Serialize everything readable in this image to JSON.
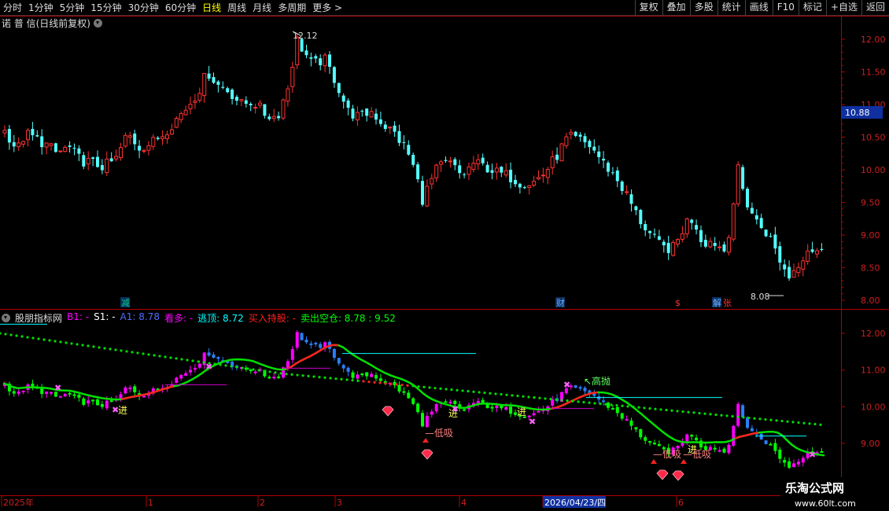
{
  "toolbar": {
    "periods": [
      "分时",
      "1分钟",
      "5分钟",
      "15分钟",
      "30分钟",
      "60分钟",
      "日线",
      "周线",
      "月线",
      "多周期",
      "更多 >"
    ],
    "active_period": "日线",
    "buttons": [
      "复权",
      "叠加",
      "多股",
      "统计",
      "画线",
      "F10",
      "标记",
      "+自选",
      "返回"
    ]
  },
  "main_chart": {
    "title": "诺 普 信(日线前复权)",
    "high_label": "12.12",
    "low_label": "8.08",
    "current_price": "10.88",
    "price_axis": [
      "12.00",
      "11.50",
      "11.00",
      "10.50",
      "10.00",
      "9.50",
      "9.00",
      "8.50",
      "8.00"
    ],
    "event_markers": [
      "减",
      "财",
      "$",
      "解",
      "张"
    ]
  },
  "indicator": {
    "name": "股朋指标网",
    "fields": [
      {
        "label": "B1: -",
        "color": "#ff00ff"
      },
      {
        "label": "S1: -",
        "color": "#ffffff"
      },
      {
        "label": "A1: 8.78",
        "color": "#4f6bff"
      },
      {
        "label": "看多: -",
        "color": "#ff00ff"
      },
      {
        "label": "逃顶: 8.72",
        "color": "#00ffff"
      },
      {
        "label": "买入持股: -",
        "color": "#ff2020"
      },
      {
        "label": "卖出空仓: 8.78 : 9.52",
        "color": "#00ff00"
      }
    ],
    "axis": [
      "12.00",
      "11.00",
      "10.00",
      "9.00"
    ],
    "annotations": {
      "enter": "进",
      "low_buy": "低吸",
      "high_sell": "高抛"
    }
  },
  "time_axis": {
    "labels": [
      "2025年",
      "1",
      "2",
      "3",
      "4",
      "2026/04/23/四",
      "6"
    ],
    "highlight": "2026/04/23/四"
  },
  "watermark": {
    "title": "乐淘公式网",
    "url": "www.60lt.com"
  },
  "colors": {
    "up": "#ff3232",
    "down": "#54ffff",
    "ind_up": "#ff00ff",
    "ind_down": "#00ff00",
    "ind_blue": "#2a7fff",
    "axis": "#cc0000"
  }
}
